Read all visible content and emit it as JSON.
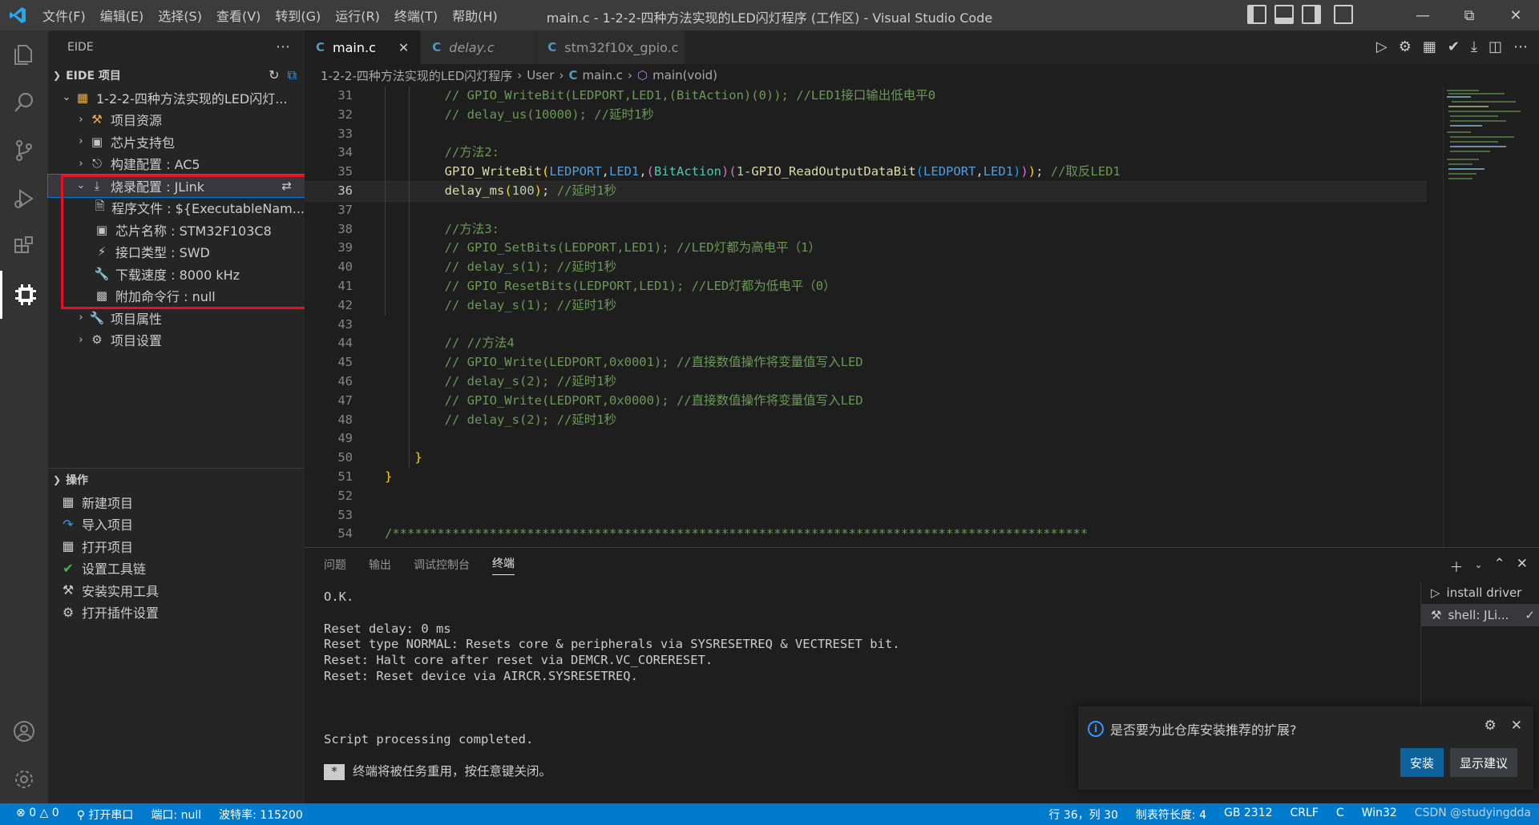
{
  "titlebar": {
    "menus": [
      "文件(F)",
      "编辑(E)",
      "选择(S)",
      "查看(V)",
      "转到(G)",
      "运行(R)",
      "终端(T)",
      "帮助(H)"
    ],
    "window_title": "main.c - 1-2-2-四种方法实现的LED闪灯程序 (工作区) - Visual Studio Code"
  },
  "sidebar": {
    "title": "EIDE",
    "section_project": "EIDE 项目",
    "project_name": "1-2-2-四种方法实现的LED闪灯...",
    "items": [
      {
        "label": "项目资源",
        "icon": "folder-tools-icon"
      },
      {
        "label": "芯片支持包",
        "icon": "chip-icon"
      },
      {
        "label": "构建配置 : AC5",
        "icon": "build-icon"
      },
      {
        "label": "烧录配置 : JLink",
        "icon": "download-icon"
      }
    ],
    "burn_children": [
      "程序文件 : ${ExecutableNam...",
      "芯片名称 : STM32F103C8",
      "接口类型 : SWD",
      "下载速度 : 8000 kHz",
      "附加命令行 : null"
    ],
    "tail_items": [
      "项目属性",
      "项目设置"
    ],
    "section_ops": "操作",
    "ops": [
      "新建项目",
      "导入项目",
      "打开项目",
      "设置工具链",
      "安装实用工具",
      "打开插件设置"
    ]
  },
  "tabs": [
    {
      "label": "main.c",
      "active": true
    },
    {
      "label": "delay.c",
      "active": false
    },
    {
      "label": "stm32f10x_gpio.c",
      "active": false
    }
  ],
  "breadcrumb": [
    "1-2-2-四种方法实现的LED闪灯程序",
    "User",
    "main.c",
    "main(void)"
  ],
  "code_lines": [
    {
      "n": "31",
      "t": "        // GPIO_WriteBit(LEDPORT,LED1,(BitAction)(0)); //LED1接口输出低电平0"
    },
    {
      "n": "32",
      "t": "        // delay_us(10000); //延时1秒"
    },
    {
      "n": "33",
      "t": ""
    },
    {
      "n": "34",
      "t": "        //方法2:"
    },
    {
      "n": "35",
      "t": "        GPIO_WriteBit(LEDPORT,LED1,(BitAction)(1-GPIO_ReadOutputDataBit(LEDPORT,LED1))); //取反LED1"
    },
    {
      "n": "36",
      "t": "        delay_ms(100); //延时1秒"
    },
    {
      "n": "37",
      "t": ""
    },
    {
      "n": "38",
      "t": "        //方法3:"
    },
    {
      "n": "39",
      "t": "        // GPIO_SetBits(LEDPORT,LED1); //LED灯都为高电平（1）"
    },
    {
      "n": "40",
      "t": "        // delay_s(1); //延时1秒"
    },
    {
      "n": "41",
      "t": "        // GPIO_ResetBits(LEDPORT,LED1); //LED灯都为低电平（0）"
    },
    {
      "n": "42",
      "t": "        // delay_s(1); //延时1秒"
    },
    {
      "n": "43",
      "t": ""
    },
    {
      "n": "44",
      "t": "        // //方法4"
    },
    {
      "n": "45",
      "t": "        // GPIO_Write(LEDPORT,0x0001); //直接数值操作将变量值写入LED"
    },
    {
      "n": "46",
      "t": "        // delay_s(2); //延时1秒"
    },
    {
      "n": "47",
      "t": "        // GPIO_Write(LEDPORT,0x0000); //直接数值操作将变量值写入LED"
    },
    {
      "n": "48",
      "t": "        // delay_s(2); //延时1秒"
    },
    {
      "n": "49",
      "t": ""
    },
    {
      "n": "50",
      "t": "    }"
    },
    {
      "n": "51",
      "t": "}"
    },
    {
      "n": "52",
      "t": ""
    },
    {
      "n": "53",
      "t": ""
    },
    {
      "n": "54",
      "t": "/*********************************************************************************************"
    }
  ],
  "panel": {
    "tabs": [
      "问题",
      "输出",
      "调试控制台",
      "终端"
    ],
    "terminal_lines": [
      "O.K.",
      "",
      "Reset delay: 0 ms",
      "Reset type NORMAL: Resets core & peripherals via SYSRESETREQ & VECTRESET bit.",
      "Reset: Halt core after reset via DEMCR.VC_CORERESET.",
      "Reset: Reset device via AIRCR.SYSRESETREQ.",
      "",
      "",
      "",
      "Script processing completed.",
      "",
      "终端将被任务重用，按任意键关闭。"
    ],
    "terminals": [
      "install driver",
      "shell: JLi..."
    ]
  },
  "notification": {
    "message": "是否要为此仓库安装推荐的扩展?",
    "install": "安装",
    "show": "显示建议"
  },
  "statusbar": {
    "errors": "0",
    "warnings": "0",
    "serial": "打开串口",
    "port": "端口: null",
    "baud": "波特率: 115200",
    "position": "行 36，列 30",
    "tab_size": "制表符长度: 4",
    "encoding": "GB 2312",
    "eol": "CRLF",
    "lang": "C",
    "platform": "Win32",
    "watermark": "CSDN @studyingdda"
  }
}
